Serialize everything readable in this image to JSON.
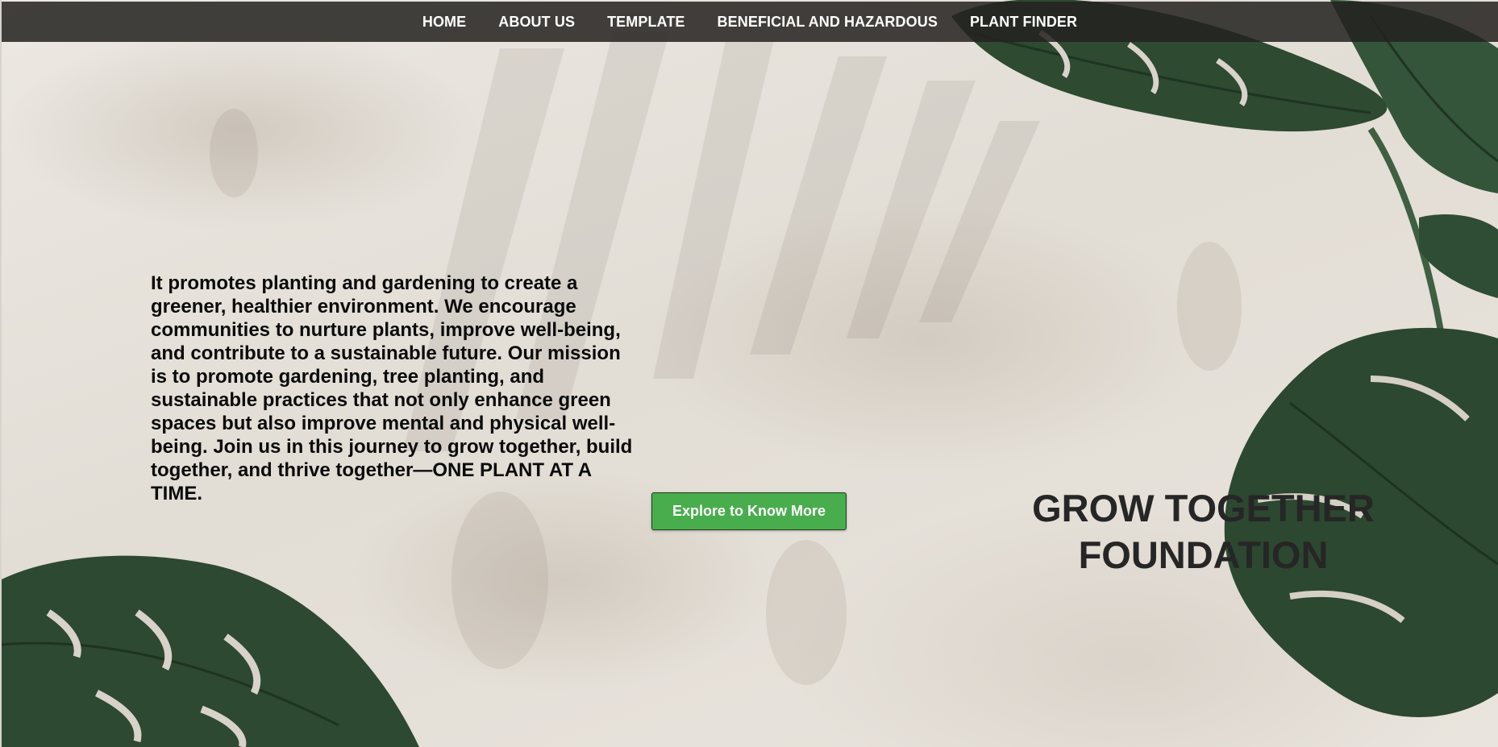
{
  "nav": {
    "items": [
      {
        "label": "HOME"
      },
      {
        "label": "ABOUT US"
      },
      {
        "label": "TEMPLATE"
      },
      {
        "label": "BENEFICIAL AND HAZARDOUS"
      },
      {
        "label": "PLANT FINDER"
      }
    ]
  },
  "hero": {
    "mission_text": "It promotes planting and gardening to create a greener, healthier environment. We encourage communities to nurture plants, improve well-being, and contribute to a sustainable future. Our mission is to promote gardening, tree planting, and sustainable practices that not only enhance green spaces but also improve mental and physical well-being. Join us in this journey to grow together, build together, and thrive together—ONE PLANT AT A TIME.",
    "cta_label": "Explore to Know More",
    "org_title_line1": "GROW TOGETHER",
    "org_title_line2": "FOUNDATION"
  },
  "colors": {
    "nav_background": "#24221f",
    "cta_background": "#48ad4c",
    "text": "#0b0b0b",
    "leaf": "#2f4a33"
  }
}
